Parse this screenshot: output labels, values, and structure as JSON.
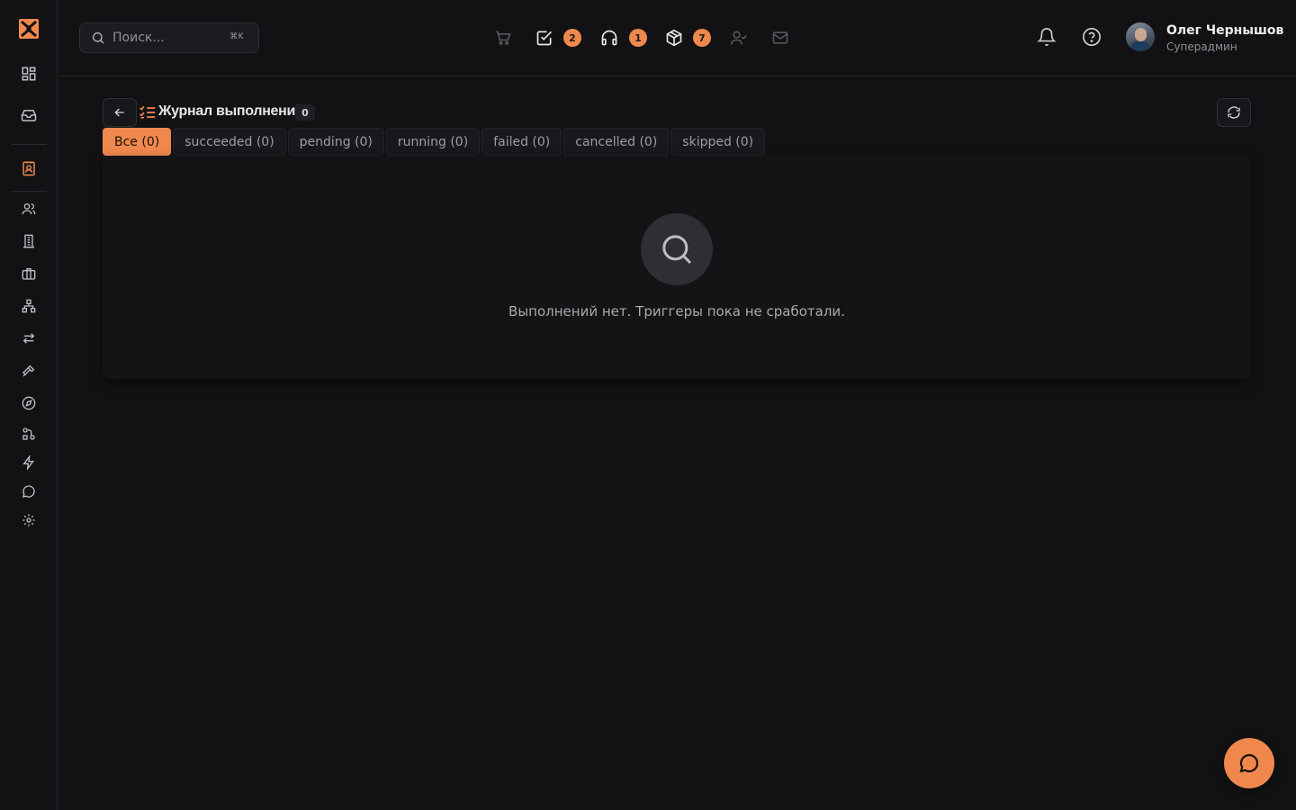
{
  "colors": {
    "accent": "#f0884e",
    "background": "#121215",
    "panel": "#141417"
  },
  "sidebar": {
    "items": [
      {
        "icon": "dashboard-icon"
      },
      {
        "icon": "inbox-icon"
      },
      {
        "icon": "contact-card-icon",
        "active": true
      },
      {
        "icon": "users-icon"
      },
      {
        "icon": "building-icon"
      },
      {
        "icon": "briefcase-icon"
      },
      {
        "icon": "hierarchy-icon"
      },
      {
        "icon": "transfer-arrows-icon"
      },
      {
        "icon": "hammer-icon"
      },
      {
        "icon": "compass-icon"
      },
      {
        "icon": "workflow-icon"
      },
      {
        "icon": "lightning-icon"
      },
      {
        "icon": "chat-icon"
      },
      {
        "icon": "gear-icon"
      }
    ]
  },
  "header": {
    "search": {
      "placeholder": "Поиск...",
      "shortcut": "⌘K"
    },
    "quick_icons": [
      {
        "icon": "cart-icon"
      },
      {
        "icon": "checkbox-icon",
        "badge": "2"
      },
      {
        "icon": "headphones-icon",
        "badge": "1"
      },
      {
        "icon": "package-icon",
        "badge": "7"
      },
      {
        "icon": "user-check-icon"
      },
      {
        "icon": "mail-icon"
      }
    ],
    "user": {
      "name": "Олег Чернышов",
      "role": "Суперадмин"
    }
  },
  "page": {
    "title": "Журнал выполнений",
    "count": "0",
    "tabs": [
      {
        "label": "Все (0)",
        "active": true
      },
      {
        "label": "succeeded (0)"
      },
      {
        "label": "pending (0)"
      },
      {
        "label": "running (0)"
      },
      {
        "label": "failed (0)"
      },
      {
        "label": "cancelled (0)"
      },
      {
        "label": "skipped (0)"
      }
    ],
    "empty_message": "Выполнений нет. Триггеры пока не сработали."
  }
}
